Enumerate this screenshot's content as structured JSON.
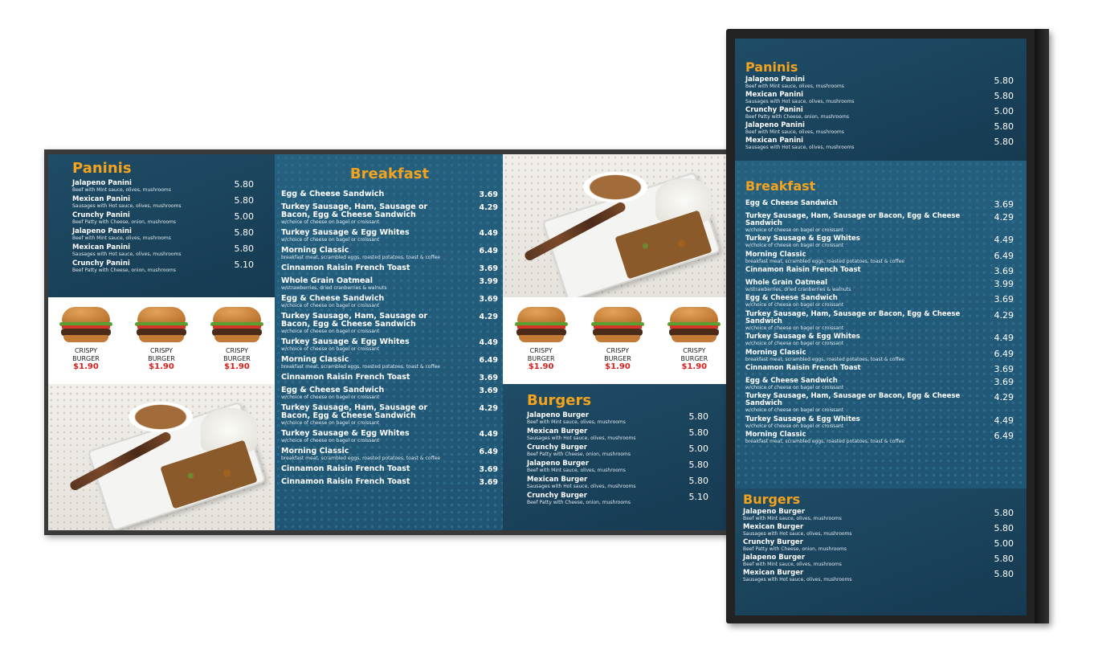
{
  "colors": {
    "title": "#f5a31c",
    "promo_price": "#d8201c",
    "panel_dark": "#1f4c66",
    "panel_mid": "#26607f"
  },
  "landscape": {
    "paninis": {
      "title": "Paninis",
      "items": [
        {
          "name": "Jalapeno Panini",
          "desc": "Beef with Mint sauce, olives, mushrooms",
          "price": "5.80"
        },
        {
          "name": "Mexican Panini",
          "desc": "Sausages with Hot sauce, olives, mushrooms",
          "price": "5.80"
        },
        {
          "name": "Crunchy Panini",
          "desc": "Beef Patty with Cheese, onion, mushrooms",
          "price": "5.00"
        },
        {
          "name": "Jalapeno Panini",
          "desc": "Beef with Mint sauce, olives, mushrooms",
          "price": "5.80"
        },
        {
          "name": "Mexican Panini",
          "desc": "Sausages with Hot sauce, olives, mushrooms",
          "price": "5.80"
        },
        {
          "name": "Crunchy Panini",
          "desc": "Beef Patty with Cheese, onion, mushrooms",
          "price": "5.10"
        }
      ]
    },
    "promo_left": [
      {
        "l1": "CRISPY",
        "l2": "BURGER",
        "price": "$1.90"
      },
      {
        "l1": "CRISPY",
        "l2": "BURGER",
        "price": "$1.90"
      },
      {
        "l1": "CRISPY",
        "l2": "BURGER",
        "price": "$1.90"
      }
    ],
    "promo_right": [
      {
        "l1": "CRISPY",
        "l2": "BURGER",
        "price": "$1.90"
      },
      {
        "l1": "CRISPY",
        "l2": "BURGER",
        "price": "$1.90"
      },
      {
        "l1": "CRISPY",
        "l2": "BURGER",
        "price": "$1.90"
      }
    ],
    "breakfast": {
      "title": "Breakfast",
      "items": [
        {
          "name": "Egg & Cheese Sandwich",
          "desc": "",
          "price": "3.69"
        },
        {
          "name": "Turkey Sausage, Ham, Sausage or Bacon, Egg & Cheese Sandwich",
          "desc": "w/choice of cheese on bagel or croissant",
          "price": "4.29"
        },
        {
          "name": "Turkey Sausage & Egg Whites",
          "desc": "w/choice of cheese on bagel or croissant",
          "price": "4.49"
        },
        {
          "name": "Morning Classic",
          "desc": "breakfast meat, scrambled eggs, roasted potatoes, toast & coffee",
          "price": "6.49"
        },
        {
          "name": "Cinnamon Raisin French Toast",
          "desc": "",
          "price": "3.69"
        },
        {
          "name": "Whole Grain Oatmeal",
          "desc": "w/strawberries, dried cranberries & walnuts",
          "price": "3.99"
        },
        {
          "name": "Egg & Cheese Sandwich",
          "desc": "w/choice of cheese on bagel or croissant",
          "price": "3.69"
        },
        {
          "name": "Turkey Sausage, Ham, Sausage or Bacon, Egg & Cheese Sandwich",
          "desc": "w/choice of cheese on bagel or croissant",
          "price": "4.29"
        },
        {
          "name": "Turkey Sausage & Egg Whites",
          "desc": "w/choice of cheese on bagel or croissant",
          "price": "4.49"
        },
        {
          "name": "Morning Classic",
          "desc": "breakfast meat, scrambled eggs, roasted potatoes, toast & coffee",
          "price": "6.49"
        },
        {
          "name": "Cinnamon Raisin French Toast",
          "desc": "",
          "price": "3.69"
        },
        {
          "name": "Egg & Cheese Sandwich",
          "desc": "w/choice of cheese on bagel or croissant",
          "price": "3.69"
        },
        {
          "name": "Turkey Sausage, Ham, Sausage or Bacon, Egg & Cheese Sandwich",
          "desc": "w/choice of cheese on bagel or croissant",
          "price": "4.29"
        },
        {
          "name": "Turkey Sausage & Egg Whites",
          "desc": "w/choice of cheese on bagel or croissant",
          "price": "4.49"
        },
        {
          "name": "Morning Classic",
          "desc": "breakfast meat, scrambled eggs, roasted potatoes, toast & coffee",
          "price": "6.49"
        },
        {
          "name": "Cinnamon Raisin French Toast",
          "desc": "",
          "price": "3.69"
        },
        {
          "name": "Cinnamon Raisin French Toast",
          "desc": "",
          "price": "3.69"
        }
      ]
    },
    "burgers": {
      "title": "Burgers",
      "items": [
        {
          "name": "Jalapeno Burger",
          "desc": "Beef with Mint sauce, olives, mushrooms",
          "price": "5.80"
        },
        {
          "name": "Mexican Burger",
          "desc": "Sausages with Hot sauce, olives, mushrooms",
          "price": "5.80"
        },
        {
          "name": "Crunchy Burger",
          "desc": "Beef Patty with Cheese, onion, mushrooms",
          "price": "5.00"
        },
        {
          "name": "Jalapeno Burger",
          "desc": "Beef with Mint sauce, olives, mushrooms",
          "price": "5.80"
        },
        {
          "name": "Mexican Burger",
          "desc": "Sausages with Hot sauce, olives, mushrooms",
          "price": "5.80"
        },
        {
          "name": "Crunchy Burger",
          "desc": "Beef Patty with Cheese, onion, mushrooms",
          "price": "5.10"
        }
      ]
    }
  },
  "portrait": {
    "paninis": {
      "title": "Paninis",
      "items": [
        {
          "name": "Jalapeno Panini",
          "desc": "Beef with Mint sauce, olives, mushrooms",
          "price": "5.80"
        },
        {
          "name": "Mexican Panini",
          "desc": "Sausages with Hot sauce, olives, mushrooms",
          "price": "5.80"
        },
        {
          "name": "Crunchy Panini",
          "desc": "Beef Patty with Cheese, onion, mushrooms",
          "price": "5.00"
        },
        {
          "name": "Jalapeno Panini",
          "desc": "Beef with Mint sauce, olives, mushrooms",
          "price": "5.80"
        },
        {
          "name": "Mexican Panini",
          "desc": "Sausages with Hot sauce, olives, mushrooms",
          "price": "5.80"
        }
      ]
    },
    "breakfast": {
      "title": "Breakfast",
      "items": [
        {
          "name": "Egg & Cheese Sandwich",
          "desc": "",
          "price": "3.69"
        },
        {
          "name": "Turkey Sausage, Ham, Sausage or Bacon, Egg & Cheese Sandwich",
          "desc": "w/choice of cheese on bagel or croissant",
          "price": "4.29"
        },
        {
          "name": "Turkey Sausage & Egg Whites",
          "desc": "w/choice of cheese on bagel or croissant",
          "price": "4.49"
        },
        {
          "name": "Morning Classic",
          "desc": "breakfast meat, scrambled eggs, roasted potatoes, toast & coffee",
          "price": "6.49"
        },
        {
          "name": "Cinnamon Raisin French Toast",
          "desc": "",
          "price": "3.69"
        },
        {
          "name": "Whole Grain Oatmeal",
          "desc": "w/strawberries, dried cranberries & walnuts",
          "price": "3.99"
        },
        {
          "name": "Egg & Cheese Sandwich",
          "desc": "w/choice of cheese on bagel or croissant",
          "price": "3.69"
        },
        {
          "name": "Turkey Sausage, Ham, Sausage or Bacon, Egg & Cheese Sandwich",
          "desc": "w/choice of cheese on bagel or croissant",
          "price": "4.29"
        },
        {
          "name": "Turkey Sausage & Egg Whites",
          "desc": "w/choice of cheese on bagel or croissant",
          "price": "4.49"
        },
        {
          "name": "Morning Classic",
          "desc": "breakfast meat, scrambled eggs, roasted potatoes, toast & coffee",
          "price": "6.49"
        },
        {
          "name": "Cinnamon Raisin French Toast",
          "desc": "",
          "price": "3.69"
        },
        {
          "name": "Egg & Cheese Sandwich",
          "desc": "w/choice of cheese on bagel or croissant",
          "price": "3.69"
        },
        {
          "name": "Turkey Sausage, Ham, Sausage or Bacon, Egg & Cheese Sandwich",
          "desc": "w/choice of cheese on bagel or croissant",
          "price": "4.29"
        },
        {
          "name": "Turkey Sausage & Egg Whites",
          "desc": "w/choice of cheese on bagel or croissant",
          "price": "4.49"
        },
        {
          "name": "Morning Classic",
          "desc": "breakfast meat, scrambled eggs, roasted potatoes, toast & coffee",
          "price": "6.49"
        }
      ]
    },
    "burgers": {
      "title": "Burgers",
      "items": [
        {
          "name": "Jalapeno Burger",
          "desc": "Beef with Mint sauce, olives, mushrooms",
          "price": "5.80"
        },
        {
          "name": "Mexican Burger",
          "desc": "Sausages with Hot sauce, olives, mushrooms",
          "price": "5.80"
        },
        {
          "name": "Crunchy Burger",
          "desc": "Beef Patty with Cheese, onion, mushrooms",
          "price": "5.00"
        },
        {
          "name": "Jalapeno Burger",
          "desc": "Beef with Mint sauce, olives, mushrooms",
          "price": "5.80"
        },
        {
          "name": "Mexican Burger",
          "desc": "Sausages with Hot sauce, olives, mushrooms",
          "price": "5.80"
        }
      ]
    }
  }
}
